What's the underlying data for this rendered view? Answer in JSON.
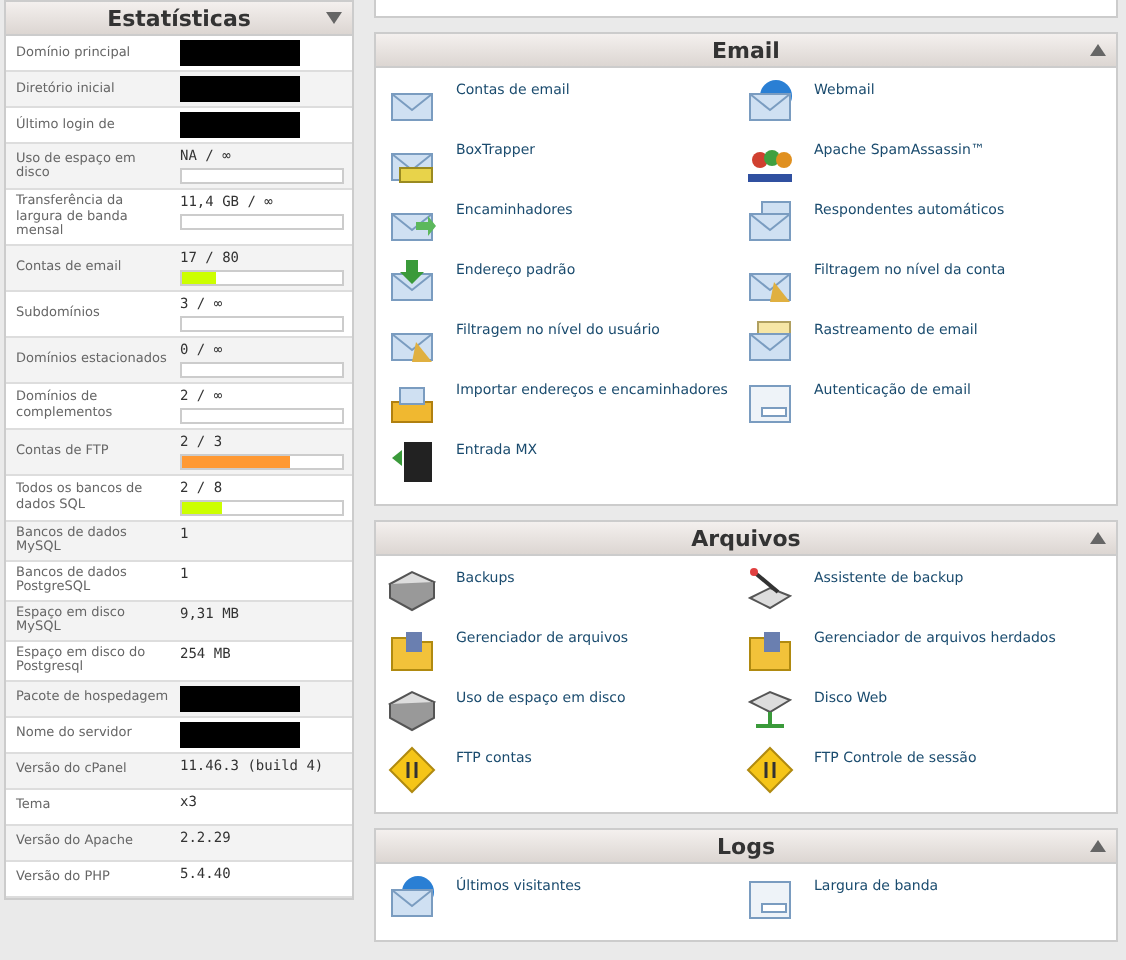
{
  "stats": {
    "title": "Estatísticas",
    "rows": [
      {
        "label": "Domínio principal",
        "redacted": true
      },
      {
        "label": "Diretório inicial",
        "redacted": true
      },
      {
        "label": "Último login de",
        "redacted": true
      },
      {
        "label": "Uso de espaço em disco",
        "value": "NA / ∞",
        "bar": true
      },
      {
        "label": "Transferência da largura de banda mensal",
        "value": "11,4 GB / ∞",
        "bar": true
      },
      {
        "label": "Contas de email",
        "value": "17 / 80",
        "level": 0.21,
        "color": "#ccff00"
      },
      {
        "label": "Subdomínios",
        "value": "3 / ∞",
        "bar": true
      },
      {
        "label": "Domínios estacionados",
        "value": "0 / ∞",
        "bar": true
      },
      {
        "label": "Domínios de complementos",
        "value": "2 / ∞",
        "bar": true
      },
      {
        "label": "Contas de FTP",
        "value": "2 / 3",
        "level": 0.67,
        "color": "#ff9933"
      },
      {
        "label": "Todos os bancos de dados SQL",
        "value": "2 / 8",
        "level": 0.25,
        "color": "#ccff00"
      },
      {
        "label": "Bancos de dados MySQL",
        "value": "1"
      },
      {
        "label": "Bancos de dados PostgreSQL",
        "value": "1"
      },
      {
        "label": "Espaço em disco MySQL",
        "value": "9,31 MB"
      },
      {
        "label": "Espaço em disco do Postgresql",
        "value": "254 MB"
      },
      {
        "label": "Pacote de hospedagem",
        "redacted": true
      },
      {
        "label": "Nome do servidor",
        "redacted": true
      },
      {
        "label": "Versão do cPanel",
        "value": "11.46.3 (build 4)"
      },
      {
        "label": "Tema",
        "value": "x3"
      },
      {
        "label": "Versão do Apache",
        "value": "2.2.29"
      },
      {
        "label": "Versão do PHP",
        "value": "5.4.40"
      }
    ]
  },
  "sections": [
    {
      "title": "Email",
      "items": [
        {
          "label": "Contas de email",
          "kind": "envelope"
        },
        {
          "label": "Webmail",
          "kind": "globe"
        },
        {
          "label": "BoxTrapper",
          "kind": "trap"
        },
        {
          "label": "Apache SpamAssassin™",
          "kind": "spam"
        },
        {
          "label": "Encaminhadores",
          "kind": "forward"
        },
        {
          "label": "Respondentes automáticos",
          "kind": "bubble"
        },
        {
          "label": "Endereço padrão",
          "kind": "download"
        },
        {
          "label": "Filtragem no nível da conta",
          "kind": "filter"
        },
        {
          "label": "Filtragem no nível do usuário",
          "kind": "filter"
        },
        {
          "label": "Rastreamento de email",
          "kind": "notes"
        },
        {
          "label": "Importar endereços e encaminhadores",
          "kind": "import"
        },
        {
          "label": "Autenticação de email",
          "kind": "form"
        },
        {
          "label": "Entrada MX",
          "kind": "server"
        }
      ]
    },
    {
      "title": "Arquivos",
      "items": [
        {
          "label": "Backups",
          "kind": "disk"
        },
        {
          "label": "Assistente de backup",
          "kind": "wand"
        },
        {
          "label": "Gerenciador de arquivos",
          "kind": "folder"
        },
        {
          "label": "Gerenciador de arquivos herdados",
          "kind": "folder"
        },
        {
          "label": "Uso de espaço em disco",
          "kind": "disk"
        },
        {
          "label": "Disco Web",
          "kind": "netdisk"
        },
        {
          "label": "FTP contas",
          "kind": "warning"
        },
        {
          "label": "FTP Controle de sessão",
          "kind": "warning"
        }
      ]
    },
    {
      "title": "Logs",
      "items": [
        {
          "label": "Últimos visitantes",
          "kind": "globe"
        },
        {
          "label": "Largura de banda",
          "kind": "form"
        }
      ]
    }
  ]
}
